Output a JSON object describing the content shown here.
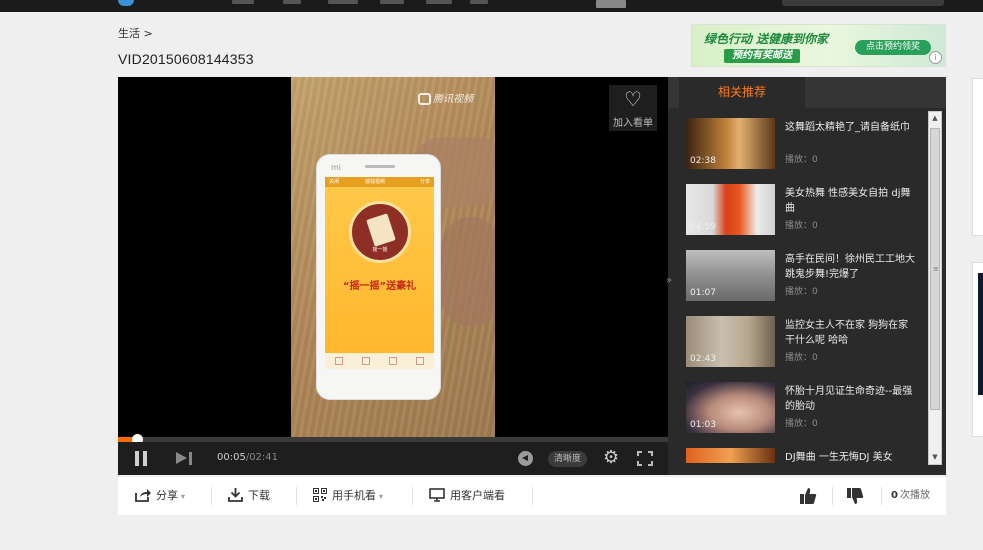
{
  "breadcrumb": {
    "category": "生活",
    "separator": ">"
  },
  "page_title": "VID20150608144353",
  "ad": {
    "line1": "绿色行动 送健康到你家",
    "line2": "预约有奖邮送",
    "button": "点击预约领奖",
    "badge": "i"
  },
  "player": {
    "watermark": "腾讯视频",
    "add_list_label": "加入看单",
    "progress_fraction": 0.035,
    "current_time": "00:05",
    "total_time": "/02:41",
    "quality_label": "清晰度",
    "screen": {
      "brand": "mi",
      "app_left": "关闭",
      "app_title": "摇钱视频",
      "app_right": "分享",
      "circle_label": "摇一摇",
      "slogan": "“摇一摇”送豪礼"
    }
  },
  "related": {
    "tab_label": "相关推荐",
    "collapse_glyph": "»",
    "items": [
      {
        "title": "这舞蹈太精艳了_请自备纸巾",
        "duration": "02:38",
        "plays": "播放：0"
      },
      {
        "title": "美女热舞 性感美女自拍 dj舞曲",
        "duration": "04:59",
        "plays": "播放：0"
      },
      {
        "title": "高手在民间！徐州民工工地大跳鬼步舞!完爆了",
        "duration": "01:07",
        "plays": "播放：0"
      },
      {
        "title": "监控女主人不在家 狗狗在家干什么呢 哈哈",
        "duration": "02:43",
        "plays": "播放：0"
      },
      {
        "title": "怀胎十月见证生命奇迹--最强的胎动",
        "duration": "01:03",
        "plays": "播放：0"
      },
      {
        "title": "DJ舞曲 一生无悔DJ 美女",
        "duration": "",
        "plays": ""
      }
    ]
  },
  "toolbar": {
    "share": "分享",
    "download": "下载",
    "phone": "用手机看",
    "client": "用客户端看",
    "play_count": "0",
    "play_suffix": "次播放"
  },
  "colors": {
    "accent": "#ff6a00",
    "tab_text": "#ff7b1a",
    "panel_bg": "#2a2a2a"
  }
}
